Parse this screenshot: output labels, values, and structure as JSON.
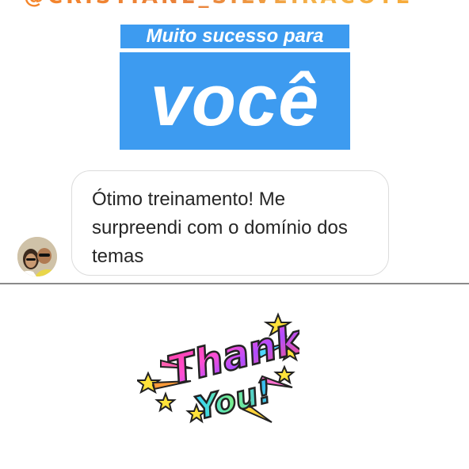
{
  "story": {
    "handle": "@CRISTIANE_SILVEIRACOTE",
    "sticker_line1": "Muito sucesso para",
    "sticker_line2": "você",
    "sticker_color": "#3d9bf0"
  },
  "reply": {
    "message": "Ótimo treinamento! Me surpreendi com o domínio dos temas"
  },
  "thank_you_sticker": {
    "line1": "Thank",
    "line2": "You!"
  }
}
